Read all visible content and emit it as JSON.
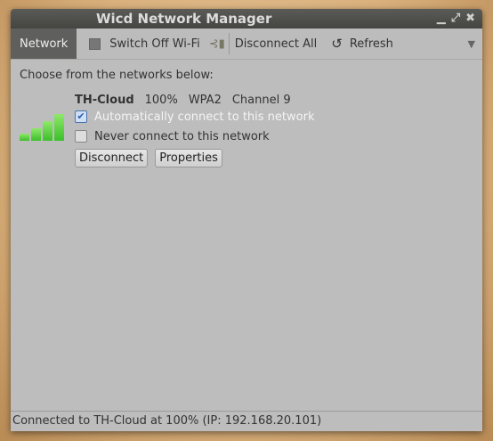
{
  "window": {
    "title": "Wicd Network Manager"
  },
  "toolbar": {
    "network": "Network",
    "switch_off_wifi": "Switch Off Wi-Fi",
    "disconnect_all": "Disconnect All",
    "refresh": "Refresh",
    "menu": "▼"
  },
  "main": {
    "prompt": "Choose from the networks below:",
    "network": {
      "ssid": "TH-Cloud",
      "strength": "100%",
      "encryption": "WPA2",
      "channel": "Channel 9",
      "signal_percent": 100,
      "auto_connect_label": "Automatically connect to this network",
      "auto_connect": true,
      "never_connect_label": "Never connect to this network",
      "never_connect": false,
      "disconnect": "Disconnect",
      "properties": "Properties"
    }
  },
  "status": "Connected to TH-Cloud at 100% (IP: 192.168.20.101)"
}
